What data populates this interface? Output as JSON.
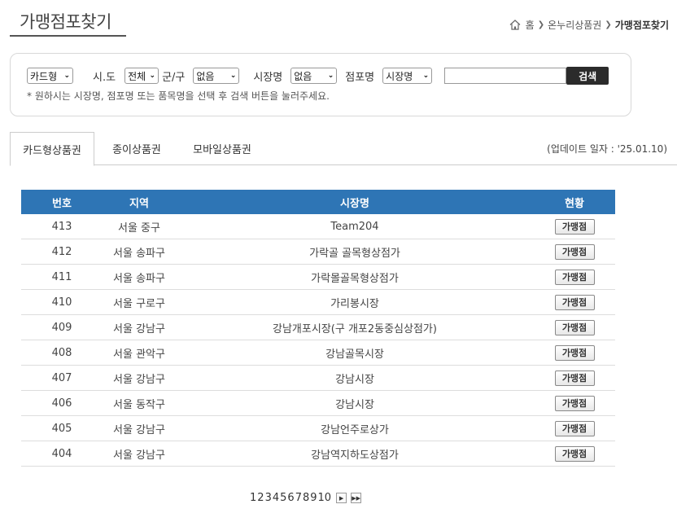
{
  "header": {
    "title": "가맹점포찾기",
    "breadcrumb": [
      "홈",
      "온누리상품권",
      "가맹점포찾기"
    ]
  },
  "search": {
    "type_select": "카드형",
    "sido_label": "시.도",
    "sido_select": "전체",
    "gugun_label": "군/구",
    "gugun_select": "없음",
    "market_label": "시장명",
    "market_select": "없음",
    "store_label": "점포명",
    "store_select": "시장명",
    "keyword_value": "",
    "button_label": "검색",
    "hint": "* 원하시는 시장명, 점포명 또는 품목명을 선택 후 검색 버튼을 눌러주세요."
  },
  "tabs": [
    {
      "label": "카드형상품권",
      "active": true
    },
    {
      "label": "종이상품권",
      "active": false
    },
    {
      "label": "모바일상품권",
      "active": false
    }
  ],
  "update_date": "(업데이트 일자 : '25.01.10)",
  "table": {
    "headers": [
      "번호",
      "지역",
      "시장명",
      "현황"
    ],
    "rows": [
      {
        "num": "413",
        "region": "서울 중구",
        "market": "Team204",
        "status": "가맹점"
      },
      {
        "num": "412",
        "region": "서울 송파구",
        "market": "가락골 골목형상점가",
        "status": "가맹점"
      },
      {
        "num": "411",
        "region": "서울 송파구",
        "market": "가락몰골목형상점가",
        "status": "가맹점"
      },
      {
        "num": "410",
        "region": "서울 구로구",
        "market": "가리봉시장",
        "status": "가맹점"
      },
      {
        "num": "409",
        "region": "서울 강남구",
        "market": "강남개포시장(구 개포2동중심상점가)",
        "status": "가맹점"
      },
      {
        "num": "408",
        "region": "서울 관악구",
        "market": "강남골목시장",
        "status": "가맹점"
      },
      {
        "num": "407",
        "region": "서울 강남구",
        "market": "강남시장",
        "status": "가맹점"
      },
      {
        "num": "406",
        "region": "서울 동작구",
        "market": "강남시장",
        "status": "가맹점"
      },
      {
        "num": "405",
        "region": "서울 강남구",
        "market": "강남언주로상가",
        "status": "가맹점"
      },
      {
        "num": "404",
        "region": "서울 강남구",
        "market": "강남역지하도상점가",
        "status": "가맹점"
      }
    ]
  },
  "pagination": {
    "pages": [
      "1",
      "2",
      "3",
      "4",
      "5",
      "6",
      "7",
      "8",
      "9",
      "10"
    ],
    "next": "▶",
    "last": "▶▶"
  }
}
